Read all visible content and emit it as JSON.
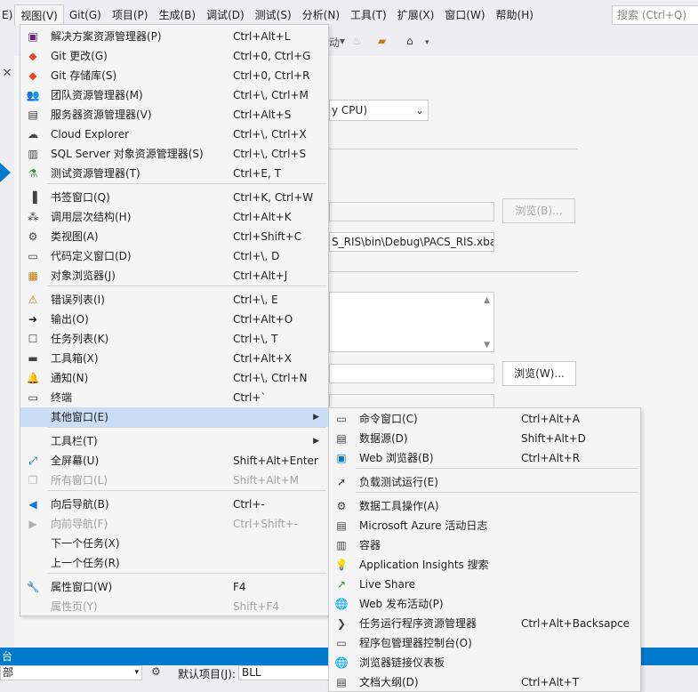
{
  "menubar": {
    "items": [
      "E)",
      "视图(V)",
      "Git(G)",
      "项目(P)",
      "生成(B)",
      "调试(D)",
      "测试(S)",
      "分析(N)",
      "工具(T)",
      "扩展(X)",
      "窗口(W)",
      "帮助(H)"
    ],
    "search_placeholder": "搜索 (Ctrl+Q)"
  },
  "toolbar": {
    "partial_label": "动"
  },
  "editor": {
    "combo_value": "y CPU)",
    "start_url_value": "S_RIS\\bin\\Debug\\PACS_RIS.xbap",
    "browse_disabled_label": "浏览(B)...",
    "browse_label": "浏览(W)..."
  },
  "bottom": {
    "panel_title": "台",
    "default_project_label": "默认项目(J):",
    "default_project_value": "BLL",
    "source_value": "部"
  },
  "view_menu": [
    {
      "icon": "solution-explorer-icon",
      "glyph": "▣",
      "label": "解决方案资源管理器(P)",
      "shortcut": "Ctrl+Alt+L",
      "color": "#68217a"
    },
    {
      "icon": "git-changes-icon",
      "glyph": "◆",
      "label": "Git 更改(G)",
      "shortcut": "Ctrl+0, Ctrl+G",
      "color": "#e8472a"
    },
    {
      "icon": "git-repository-icon",
      "glyph": "◆",
      "label": "Git 存储库(S)",
      "shortcut": "Ctrl+0, Ctrl+R",
      "color": "#e8472a"
    },
    {
      "icon": "team-explorer-icon",
      "glyph": "👥",
      "label": "团队资源管理器(M)",
      "shortcut": "Ctrl+\\, Ctrl+M",
      "color": "#424242"
    },
    {
      "icon": "server-explorer-icon",
      "glyph": "▤",
      "label": "服务器资源管理器(V)",
      "shortcut": "Ctrl+Alt+S",
      "color": "#424242"
    },
    {
      "icon": "cloud-icon",
      "glyph": "☁",
      "label": "Cloud Explorer",
      "shortcut": "Ctrl+\\, Ctrl+X",
      "color": "#424242"
    },
    {
      "icon": "sql-server-icon",
      "glyph": "▥",
      "label": "SQL Server 对象资源管理器(S)",
      "shortcut": "Ctrl+\\, Ctrl+S",
      "color": "#424242"
    },
    {
      "icon": "test-explorer-icon",
      "glyph": "⚗",
      "label": "测试资源管理器(T)",
      "shortcut": "Ctrl+E, T",
      "color": "#388a34"
    },
    {
      "icon": "bookmark-icon",
      "glyph": "▐",
      "label": "书签窗口(Q)",
      "shortcut": "Ctrl+K, Ctrl+W",
      "color": "#424242"
    },
    {
      "icon": "call-hierarchy-icon",
      "glyph": "⁂",
      "label": "调用层次结构(H)",
      "shortcut": "Ctrl+Alt+K",
      "color": "#424242"
    },
    {
      "icon": "class-view-icon",
      "glyph": "⚙",
      "label": "类视图(A)",
      "shortcut": "Ctrl+Shift+C",
      "color": "#424242"
    },
    {
      "icon": "code-definition-icon",
      "glyph": "▭",
      "label": "代码定义窗口(D)",
      "shortcut": "Ctrl+\\, D",
      "color": "#424242"
    },
    {
      "icon": "object-browser-icon",
      "glyph": "▦",
      "label": "对象浏览器(J)",
      "shortcut": "Ctrl+Alt+J",
      "color": "#c27d0e"
    },
    {
      "icon": "error-list-icon",
      "glyph": "⚠",
      "label": "错误列表(I)",
      "shortcut": "Ctrl+\\, E",
      "color": "#c27d0e"
    },
    {
      "icon": "output-icon",
      "glyph": "➜",
      "label": "输出(O)",
      "shortcut": "Ctrl+Alt+O",
      "color": "#1e1e1e"
    },
    {
      "icon": "task-list-icon",
      "glyph": "☐",
      "label": "任务列表(K)",
      "shortcut": "Ctrl+\\, T",
      "color": "#424242"
    },
    {
      "icon": "toolbox-icon",
      "glyph": "▬",
      "label": "工具箱(X)",
      "shortcut": "Ctrl+Alt+X",
      "color": "#424242"
    },
    {
      "icon": "notification-icon",
      "glyph": "🔔",
      "label": "通知(N)",
      "shortcut": "Ctrl+\\, Ctrl+N",
      "color": "#424242"
    },
    {
      "icon": "terminal-icon",
      "glyph": "▭",
      "label": "终端",
      "shortcut": "Ctrl+`",
      "color": "#424242"
    },
    {
      "icon": "none",
      "glyph": "",
      "label": "其他窗口(E)",
      "shortcut": "",
      "color": "#424242"
    },
    {
      "icon": "none",
      "glyph": "",
      "label": "工具栏(T)",
      "shortcut": "",
      "color": "#424242"
    },
    {
      "icon": "fullscreen-icon",
      "glyph": "⤢",
      "label": "全屏幕(U)",
      "shortcut": "Shift+Alt+Enter",
      "color": "#007acc"
    },
    {
      "icon": "all-windows-icon",
      "glyph": "❐",
      "label": "所有窗口(L)",
      "shortcut": "Shift+Alt+M",
      "color": "#b0b0b0"
    },
    {
      "icon": "navigate-back-icon",
      "glyph": "◀",
      "label": "向后导航(B)",
      "shortcut": "Ctrl+-",
      "color": "#007acc"
    },
    {
      "icon": "navigate-forward-icon",
      "glyph": "▶",
      "label": "向前导航(F)",
      "shortcut": "Ctrl+Shift+-",
      "color": "#b0b0b0"
    },
    {
      "icon": "none",
      "glyph": "",
      "label": "下一个任务(X)",
      "shortcut": "",
      "color": "#424242"
    },
    {
      "icon": "none",
      "glyph": "",
      "label": "上一个任务(R)",
      "shortcut": "",
      "color": "#424242"
    },
    {
      "icon": "properties-icon",
      "glyph": "🔧",
      "label": "属性窗口(W)",
      "shortcut": "F4",
      "color": "#424242"
    },
    {
      "icon": "none",
      "glyph": "",
      "label": "属性页(Y)",
      "shortcut": "Shift+F4",
      "color": "#424242"
    }
  ],
  "other_windows_menu": [
    {
      "icon": "command-window-icon",
      "glyph": "▭",
      "label": "命令窗口(C)",
      "shortcut": "Ctrl+Alt+A",
      "color": "#424242"
    },
    {
      "icon": "data-sources-icon",
      "glyph": "▤",
      "label": "数据源(D)",
      "shortcut": "Shift+Alt+D",
      "color": "#424242"
    },
    {
      "icon": "web-browser-icon",
      "glyph": "▣",
      "label": "Web 浏览器(B)",
      "shortcut": "Ctrl+Alt+R",
      "color": "#007acc"
    },
    {
      "icon": "load-test-icon",
      "glyph": "➚",
      "label": "负载测试运行(E)",
      "shortcut": "",
      "color": "#424242"
    },
    {
      "icon": "data-tools-icon",
      "glyph": "⚙",
      "label": "数据工具操作(A)",
      "shortcut": "",
      "color": "#424242"
    },
    {
      "icon": "azure-log-icon",
      "glyph": "▤",
      "label": "Microsoft Azure 活动日志",
      "shortcut": "",
      "color": "#424242"
    },
    {
      "icon": "container-icon",
      "glyph": "▥",
      "label": "容器",
      "shortcut": "",
      "color": "#424242"
    },
    {
      "icon": "app-insights-icon",
      "glyph": "💡",
      "label": "Application Insights 搜索",
      "shortcut": "",
      "color": "#68217a"
    },
    {
      "icon": "live-share-icon",
      "glyph": "↗",
      "label": "Live Share",
      "shortcut": "",
      "color": "#388a34"
    },
    {
      "icon": "web-publish-icon",
      "glyph": "🌐",
      "label": "Web 发布活动(P)",
      "shortcut": "",
      "color": "#007acc"
    },
    {
      "icon": "task-runner-icon",
      "glyph": "❯",
      "label": "任务运行程序资源管理器",
      "shortcut": "Ctrl+Alt+Backsapce",
      "color": "#424242"
    },
    {
      "icon": "package-manager-icon",
      "glyph": "▭",
      "label": "程序包管理器控制台(O)",
      "shortcut": "",
      "color": "#424242"
    },
    {
      "icon": "browser-link-icon",
      "glyph": "🌐",
      "label": "浏览器链接仪表板",
      "shortcut": "",
      "color": "#007acc"
    },
    {
      "icon": "document-outline-icon",
      "glyph": "▤",
      "label": "文档大纲(D)",
      "shortcut": "Ctrl+Alt+T",
      "color": "#424242"
    }
  ]
}
